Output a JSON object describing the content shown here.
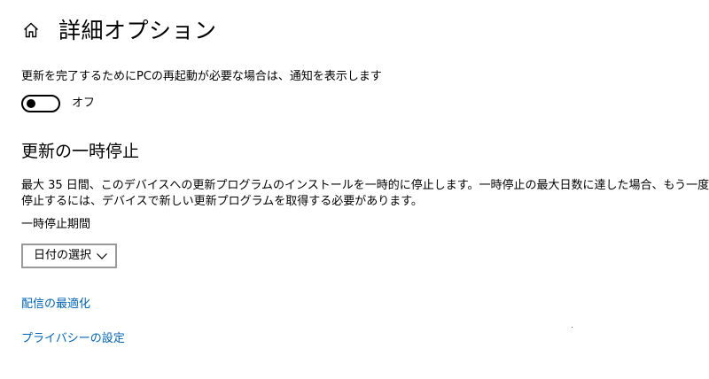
{
  "header": {
    "title": "詳細オプション",
    "home_icon": "home-icon"
  },
  "notification": {
    "description": "更新を完了するためにPCの再起動が必要な場合は、通知を表示します",
    "toggle_state_label": "オフ",
    "toggle_on": false
  },
  "pause_section": {
    "title": "更新の一時停止",
    "description_line1": "最大 35 日間、このデバイスへの更新プログラムのインストールを一時的に停止します。一時停止の最大日数に達した場合、もう一度一時",
    "description_line2": "停止するには、デバイスで新しい更新プログラムを取得する必要があります。",
    "period_label": "一時停止期間",
    "date_select_value": "日付の選択"
  },
  "links": {
    "delivery_optimization": "配信の最適化",
    "privacy_settings": "プライバシーの設定"
  },
  "colors": {
    "link": "#0063b1",
    "text": "#000000",
    "select_border": "#999999",
    "background": "#ffffff"
  }
}
